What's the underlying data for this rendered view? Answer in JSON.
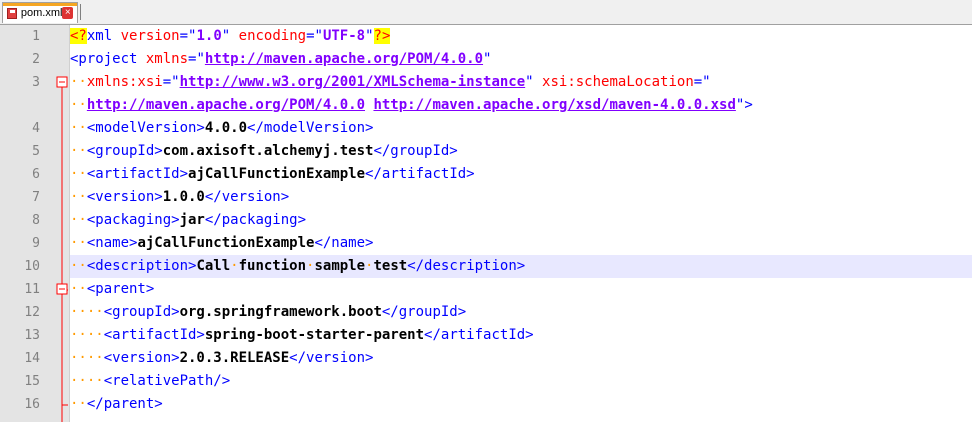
{
  "tab": {
    "filename": "pom.xml",
    "close_glyph": "×",
    "icon": "floppy-disk-icon"
  },
  "colors": {
    "tag": "#0000ff",
    "attr": "#ff0000",
    "value": "#8000ff",
    "pi_bg": "#ffff00",
    "guide": "#ff9a00",
    "current_line": "#e8e8ff"
  },
  "lines": [
    {
      "n": "1",
      "segs": [
        [
          "pi",
          "<?"
        ],
        [
          "tag",
          "xml"
        ],
        [
          "ws",
          " "
        ],
        [
          "attr",
          "version"
        ],
        [
          "tag",
          "=\""
        ],
        [
          "val",
          "1.0"
        ],
        [
          "tag",
          "\""
        ],
        [
          "ws",
          " "
        ],
        [
          "attr",
          "encoding"
        ],
        [
          "tag",
          "=\""
        ],
        [
          "val",
          "UTF-8"
        ],
        [
          "tag",
          "\""
        ],
        [
          "pi",
          "?>"
        ]
      ]
    },
    {
      "n": "2",
      "segs": [
        [
          "tag",
          "<project"
        ],
        [
          "ws",
          " "
        ],
        [
          "attr",
          "xmlns"
        ],
        [
          "tag",
          "=\""
        ],
        [
          "valu",
          "http://maven.apache.org/POM/4.0.0"
        ],
        [
          "tag",
          "\""
        ]
      ]
    },
    {
      "n": "3",
      "segs": [
        [
          "ws",
          "··"
        ],
        [
          "attr",
          "xmlns:xsi"
        ],
        [
          "tag",
          "=\""
        ],
        [
          "valu",
          "http://www.w3.org/2001/XMLSchema-instance"
        ],
        [
          "tag",
          "\""
        ],
        [
          "ws",
          " "
        ],
        [
          "attr",
          "xsi:schemaLocation"
        ],
        [
          "tag",
          "=\""
        ]
      ]
    },
    {
      "n": "",
      "segs": [
        [
          "ws",
          "··"
        ],
        [
          "valu",
          "http://maven.apache.org/POM/4.0.0"
        ],
        [
          "ws",
          " "
        ],
        [
          "valu",
          "http://maven.apache.org/xsd/maven-4.0.0.xsd"
        ],
        [
          "tag",
          "\">"
        ]
      ]
    },
    {
      "n": "4",
      "segs": [
        [
          "ws",
          "··"
        ],
        [
          "tag",
          "<modelVersion>"
        ],
        [
          "txt",
          "4.0.0"
        ],
        [
          "tag",
          "</modelVersion>"
        ]
      ]
    },
    {
      "n": "5",
      "segs": [
        [
          "ws",
          "··"
        ],
        [
          "tag",
          "<groupId>"
        ],
        [
          "txt",
          "com.axisoft.alchemyj.test"
        ],
        [
          "tag",
          "</groupId>"
        ]
      ]
    },
    {
      "n": "6",
      "segs": [
        [
          "ws",
          "··"
        ],
        [
          "tag",
          "<artifactId>"
        ],
        [
          "txt",
          "ajCallFunctionExample"
        ],
        [
          "tag",
          "</artifactId>"
        ]
      ]
    },
    {
      "n": "7",
      "segs": [
        [
          "ws",
          "··"
        ],
        [
          "tag",
          "<version>"
        ],
        [
          "txt",
          "1.0.0"
        ],
        [
          "tag",
          "</version>"
        ]
      ]
    },
    {
      "n": "8",
      "segs": [
        [
          "ws",
          "··"
        ],
        [
          "tag",
          "<packaging>"
        ],
        [
          "txt",
          "jar"
        ],
        [
          "tag",
          "</packaging>"
        ]
      ]
    },
    {
      "n": "9",
      "segs": [
        [
          "ws",
          "··"
        ],
        [
          "tag",
          "<name>"
        ],
        [
          "txt",
          "ajCallFunctionExample"
        ],
        [
          "tag",
          "</name>"
        ]
      ]
    },
    {
      "n": "10",
      "current": true,
      "segs": [
        [
          "ws",
          "··"
        ],
        [
          "tag",
          "<description>"
        ],
        [
          "txt",
          "Call"
        ],
        [
          "ws",
          "·"
        ],
        [
          "txt",
          "function"
        ],
        [
          "ws",
          "·"
        ],
        [
          "txt",
          "sample"
        ],
        [
          "ws",
          "·"
        ],
        [
          "txt",
          "test"
        ],
        [
          "tag",
          "</description>"
        ]
      ]
    },
    {
      "n": "11",
      "segs": [
        [
          "ws",
          "··"
        ],
        [
          "tag",
          "<parent>"
        ]
      ]
    },
    {
      "n": "12",
      "segs": [
        [
          "ws",
          "····"
        ],
        [
          "tag",
          "<groupId>"
        ],
        [
          "txt",
          "org.springframework.boot"
        ],
        [
          "tag",
          "</groupId>"
        ]
      ]
    },
    {
      "n": "13",
      "segs": [
        [
          "ws",
          "····"
        ],
        [
          "tag",
          "<artifactId>"
        ],
        [
          "txt",
          "spring-boot-starter-parent"
        ],
        [
          "tag",
          "</artifactId>"
        ]
      ]
    },
    {
      "n": "14",
      "segs": [
        [
          "ws",
          "····"
        ],
        [
          "tag",
          "<version>"
        ],
        [
          "txt",
          "2.0.3.RELEASE"
        ],
        [
          "tag",
          "</version>"
        ]
      ]
    },
    {
      "n": "15",
      "segs": [
        [
          "ws",
          "····"
        ],
        [
          "tag",
          "<relativePath/>"
        ]
      ]
    },
    {
      "n": "16",
      "segs": [
        [
          "ws",
          "··"
        ],
        [
          "tag",
          "</parent>"
        ]
      ]
    }
  ]
}
